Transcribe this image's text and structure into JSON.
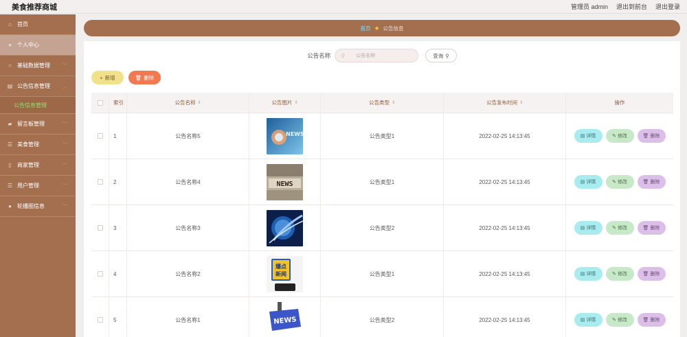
{
  "header": {
    "brand": "美食推荐商城",
    "admin": "管理员 admin",
    "front": "退出到前台",
    "logout": "退出登录"
  },
  "sidebar": {
    "items": [
      {
        "label": "首页",
        "icon": "home-icon"
      },
      {
        "label": "个人中心",
        "icon": "user-icon"
      },
      {
        "label": "基础数据管理",
        "icon": "data-icon"
      },
      {
        "label": "公告信息管理",
        "icon": "notice-icon"
      },
      {
        "label": "留言板管理",
        "icon": "message-icon"
      },
      {
        "label": "美食管理",
        "icon": "food-icon"
      },
      {
        "label": "商家管理",
        "icon": "shop-icon"
      },
      {
        "label": "用户管理",
        "icon": "users-icon"
      },
      {
        "label": "轮播图信息",
        "icon": "carousel-icon"
      }
    ],
    "sub_active": "公告信息管理"
  },
  "breadcrumb": {
    "home": "首页",
    "current": "公告信息"
  },
  "search": {
    "label": "公告名称",
    "placeholder": "公告名称",
    "button": "查询"
  },
  "toolbar": {
    "add": "新增",
    "delete": "删除"
  },
  "table": {
    "headers": {
      "index": "索引",
      "name": "公告名称",
      "image": "公告图片",
      "type": "公告类型",
      "time": "公告发布时间",
      "ops": "操作"
    },
    "rows": [
      {
        "index": "1",
        "name": "公告名称5",
        "type": "公告类型1",
        "time": "2022-02-25 14:13:45"
      },
      {
        "index": "2",
        "name": "公告名称4",
        "type": "公告类型1",
        "time": "2022-02-25 14:13:45"
      },
      {
        "index": "3",
        "name": "公告名称3",
        "type": "公告类型2",
        "time": "2022-02-25 14:13:45"
      },
      {
        "index": "4",
        "name": "公告名称2",
        "type": "公告类型1",
        "time": "2022-02-25 14:13:45"
      },
      {
        "index": "5",
        "name": "公告名称1",
        "type": "公告类型2",
        "time": "2022-02-25 14:13:45"
      }
    ],
    "thumb_text": [
      "NEWS",
      "NEWS",
      "",
      "爆点\n新闻",
      "NEWS"
    ],
    "ops": {
      "detail": "详情",
      "edit": "修改",
      "delete": "删除"
    }
  },
  "colors": {
    "primary": "#a46f4f",
    "sidebar_active": "#c4a392",
    "sub_text": "#8fe26a",
    "add_btn": "#f1e18a",
    "delete_btn": "#f2784f",
    "detail_btn": "#a9ecef",
    "edit_btn": "#c8e9c7",
    "del_btn": "#dcbfe8"
  }
}
